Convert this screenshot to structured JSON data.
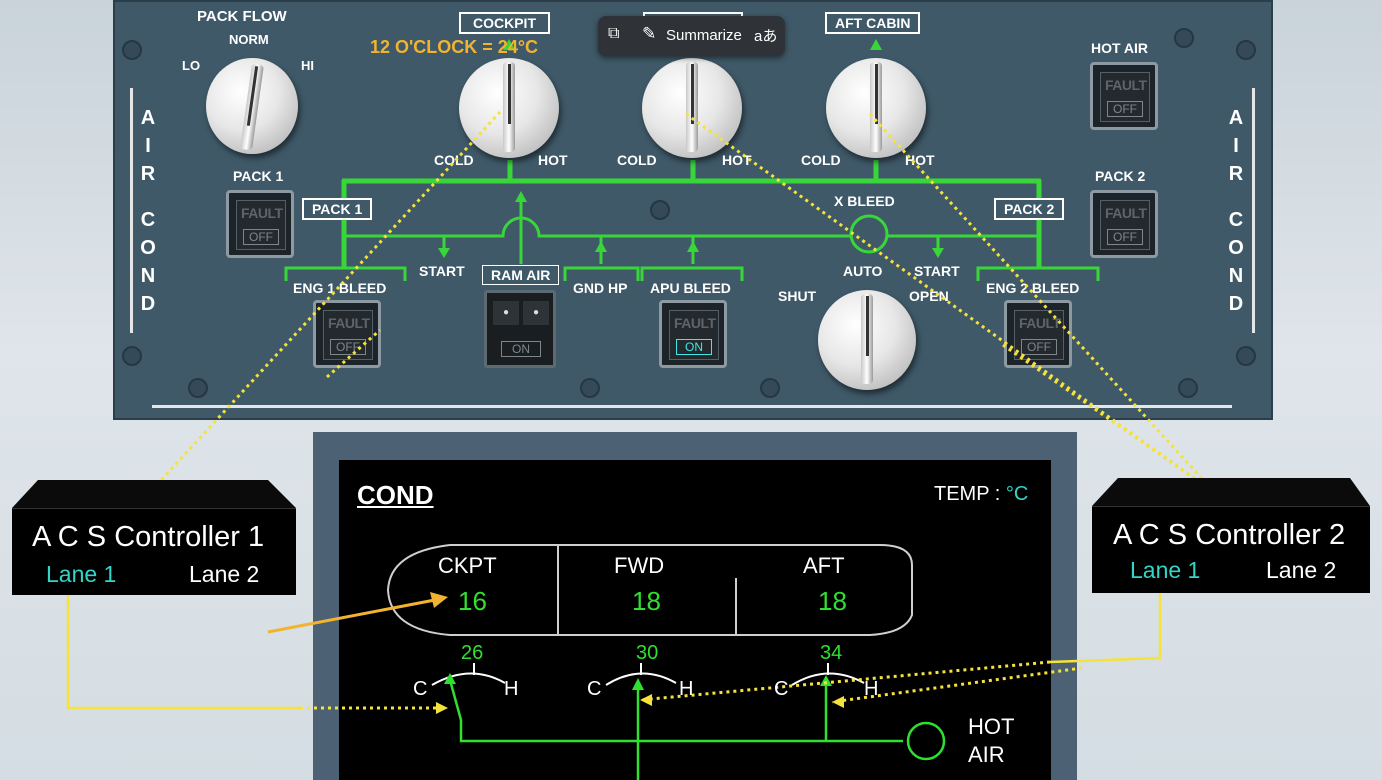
{
  "panel": {
    "pack_flow": {
      "title": "PACK FLOW",
      "lo": "LO",
      "norm": "NORM",
      "hi": "HI"
    },
    "side_label_chars": [
      "A",
      "I",
      "R",
      "C",
      "O",
      "N",
      "D"
    ],
    "cockpit": "COCKPIT",
    "fwd_cabin": "",
    "aft_cabin": "AFT CABIN",
    "twelve_oclock": "12 O'CLOCK = 24°C",
    "cold": "COLD",
    "hot": "HOT",
    "hot_air": "HOT AIR",
    "pack1": "PACK 1",
    "pack2": "PACK 2",
    "fault": "FAULT",
    "off": "OFF",
    "on": "ON",
    "x_bleed": "X BLEED",
    "start": "START",
    "ram_air": "RAM AIR",
    "gnd_hp": "GND HP",
    "apu_bleed": "APU BLEED",
    "eng1_bleed": "ENG 1 BLEED",
    "eng2_bleed": "ENG 2 BLEED",
    "shut": "SHUT",
    "auto": "AUTO",
    "open": "OPEN"
  },
  "toolbar": {
    "summarize": "Summarize"
  },
  "ecam": {
    "title": "COND",
    "temp": "TEMP : ",
    "unit": "°C",
    "zones": [
      {
        "name": "CKPT",
        "temp": "16",
        "duct": "26"
      },
      {
        "name": "FWD",
        "temp": "18",
        "duct": "30"
      },
      {
        "name": "AFT",
        "temp": "18",
        "duct": "34"
      }
    ],
    "c": "C",
    "h": "H",
    "hot_air_1": "HOT",
    "hot_air_2": "AIR"
  },
  "controllers": [
    {
      "name": "A C S Controller 1",
      "lane1": "Lane 1",
      "lane2": "Lane 2"
    },
    {
      "name": "A C S Controller 2",
      "lane1": "Lane 1",
      "lane2": "Lane 2"
    }
  ],
  "colors": {
    "panel": "#3f5968",
    "duct": "#39d639",
    "ecam_green": "#2fe02f",
    "lane_cyan": "#31d6c8",
    "annotation_yellow": "#f5e23a"
  }
}
